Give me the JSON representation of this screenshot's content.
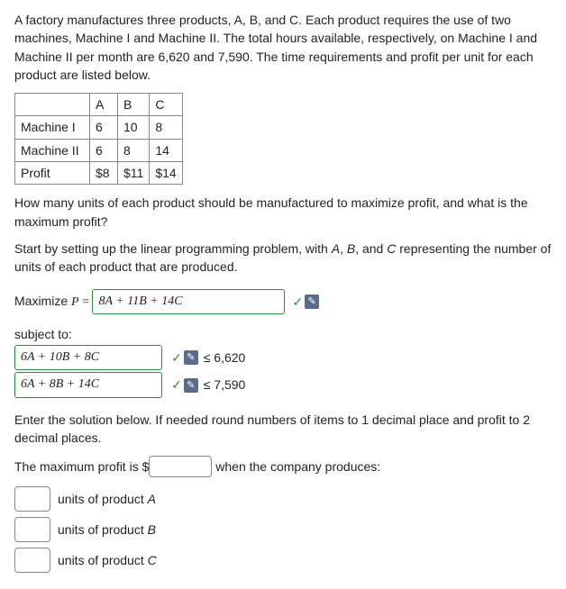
{
  "intro": "A factory manufactures three products, A, B, and C. Each product requires the use of two machines, Machine I and Machine II. The total hours available, respectively, on Machine I and Machine II per month are 6,620 and 7,590. The time requirements and profit per unit for each product are listed below.",
  "table": {
    "cols": [
      "A",
      "B",
      "C"
    ],
    "rows": [
      {
        "label": "Machine I",
        "vals": [
          "6",
          "10",
          "8"
        ]
      },
      {
        "label": "Machine II",
        "vals": [
          "6",
          "8",
          "14"
        ]
      },
      {
        "label": "Profit",
        "vals": [
          "$8",
          "$11",
          "$14"
        ]
      }
    ]
  },
  "question": "How many units of each product should be manufactured to maximize profit, and what is the maximum profit?",
  "setup_prefix": "Start by setting up the linear programming problem, with ",
  "setup_mid1": ", ",
  "setup_mid2": ", and ",
  "setup_suffix": " representing the number of units of each product that are produced.",
  "vars": {
    "A": "A",
    "B": "B",
    "C": "C"
  },
  "maximize": {
    "label_pre": "Maximize ",
    "P": "P",
    "eq": " = ",
    "expr": "8A + 11B + 14C"
  },
  "subject_label": "subject to:",
  "constraints": [
    {
      "expr": "6A + 10B + 8C",
      "rhs": "≤ 6,620"
    },
    {
      "expr": "6A + 8B + 14C",
      "rhs": "≤ 7,590"
    }
  ],
  "solution_instr": "Enter the solution below. If needed round numbers of items to 1 decimal place and profit to 2 decimal places.",
  "profit_line": {
    "pre": "The maximum profit is $",
    "post": "when the company produces:"
  },
  "unit_lines": [
    {
      "pre": "units of product ",
      "var": "A"
    },
    {
      "pre": "units of product ",
      "var": "B"
    },
    {
      "pre": "units of product ",
      "var": "C"
    }
  ],
  "icons": {
    "tick": "✓",
    "sq": "✎"
  }
}
